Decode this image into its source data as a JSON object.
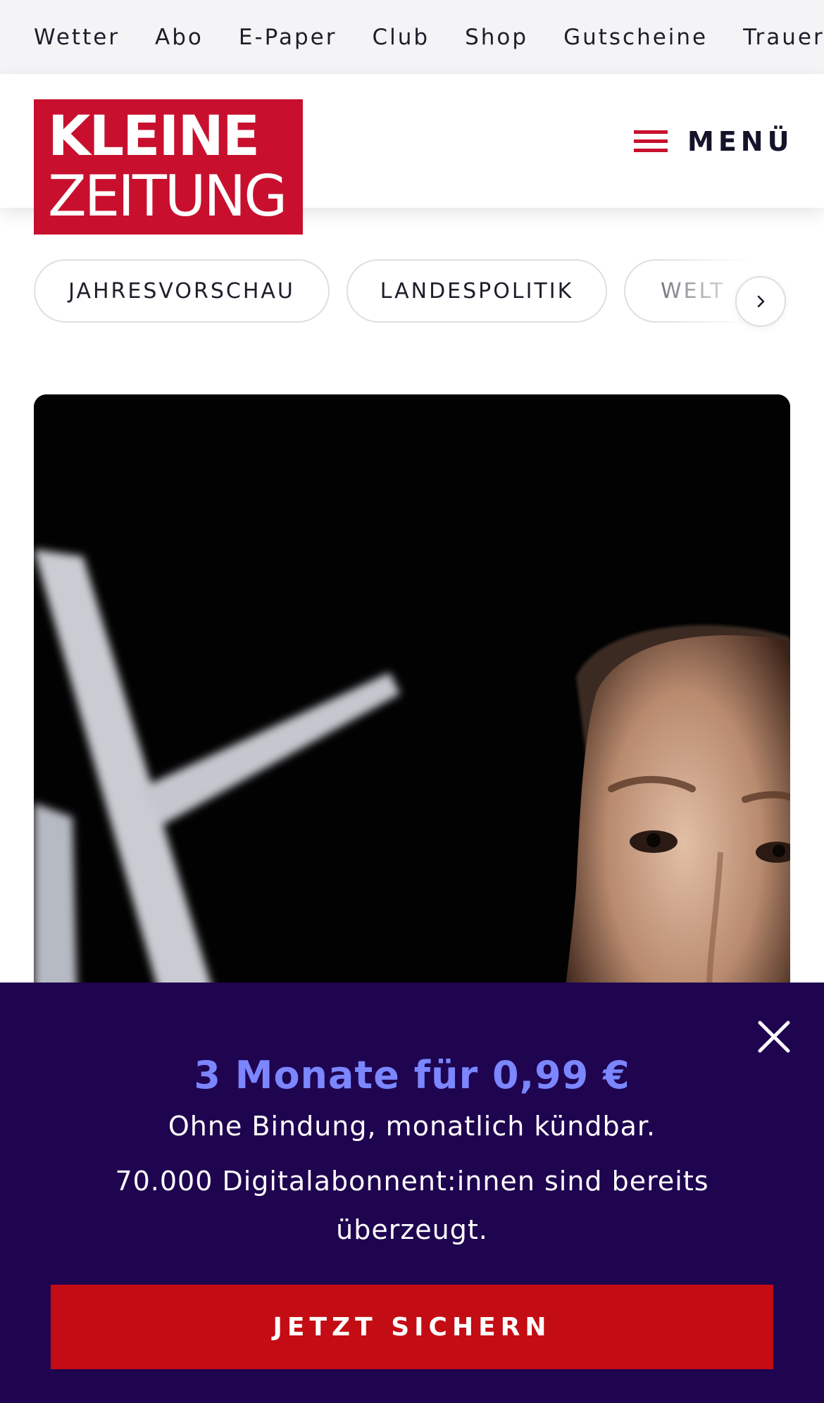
{
  "service_nav": {
    "items": [
      "Wetter",
      "Abo",
      "E-Paper",
      "Club",
      "Shop",
      "Gutscheine",
      "Trauerportal"
    ]
  },
  "header": {
    "logo_line1": "KLEINE",
    "logo_line2": "ZEITUNG",
    "menu_label": "MENÜ"
  },
  "topics": {
    "items": [
      "JAHRESVORSCHAU",
      "LANDESPOLITIK",
      "WELT"
    ]
  },
  "hero": {
    "image": "portrait-with-x-logo"
  },
  "promo": {
    "headline": "3 Monate für 0,99 €",
    "subline": "Ohne Bindung, monatlich kündbar.",
    "text": "70.000 Digitalabonnent:innen sind bereits überzeugt.",
    "cta_label": "JETZT SICHERN",
    "close_icon": "close-icon"
  },
  "colors": {
    "brand_red": "#c8102e",
    "promo_bg": "#1f0450",
    "promo_headline": "#7b86ff",
    "cta_red": "#c40c14"
  }
}
